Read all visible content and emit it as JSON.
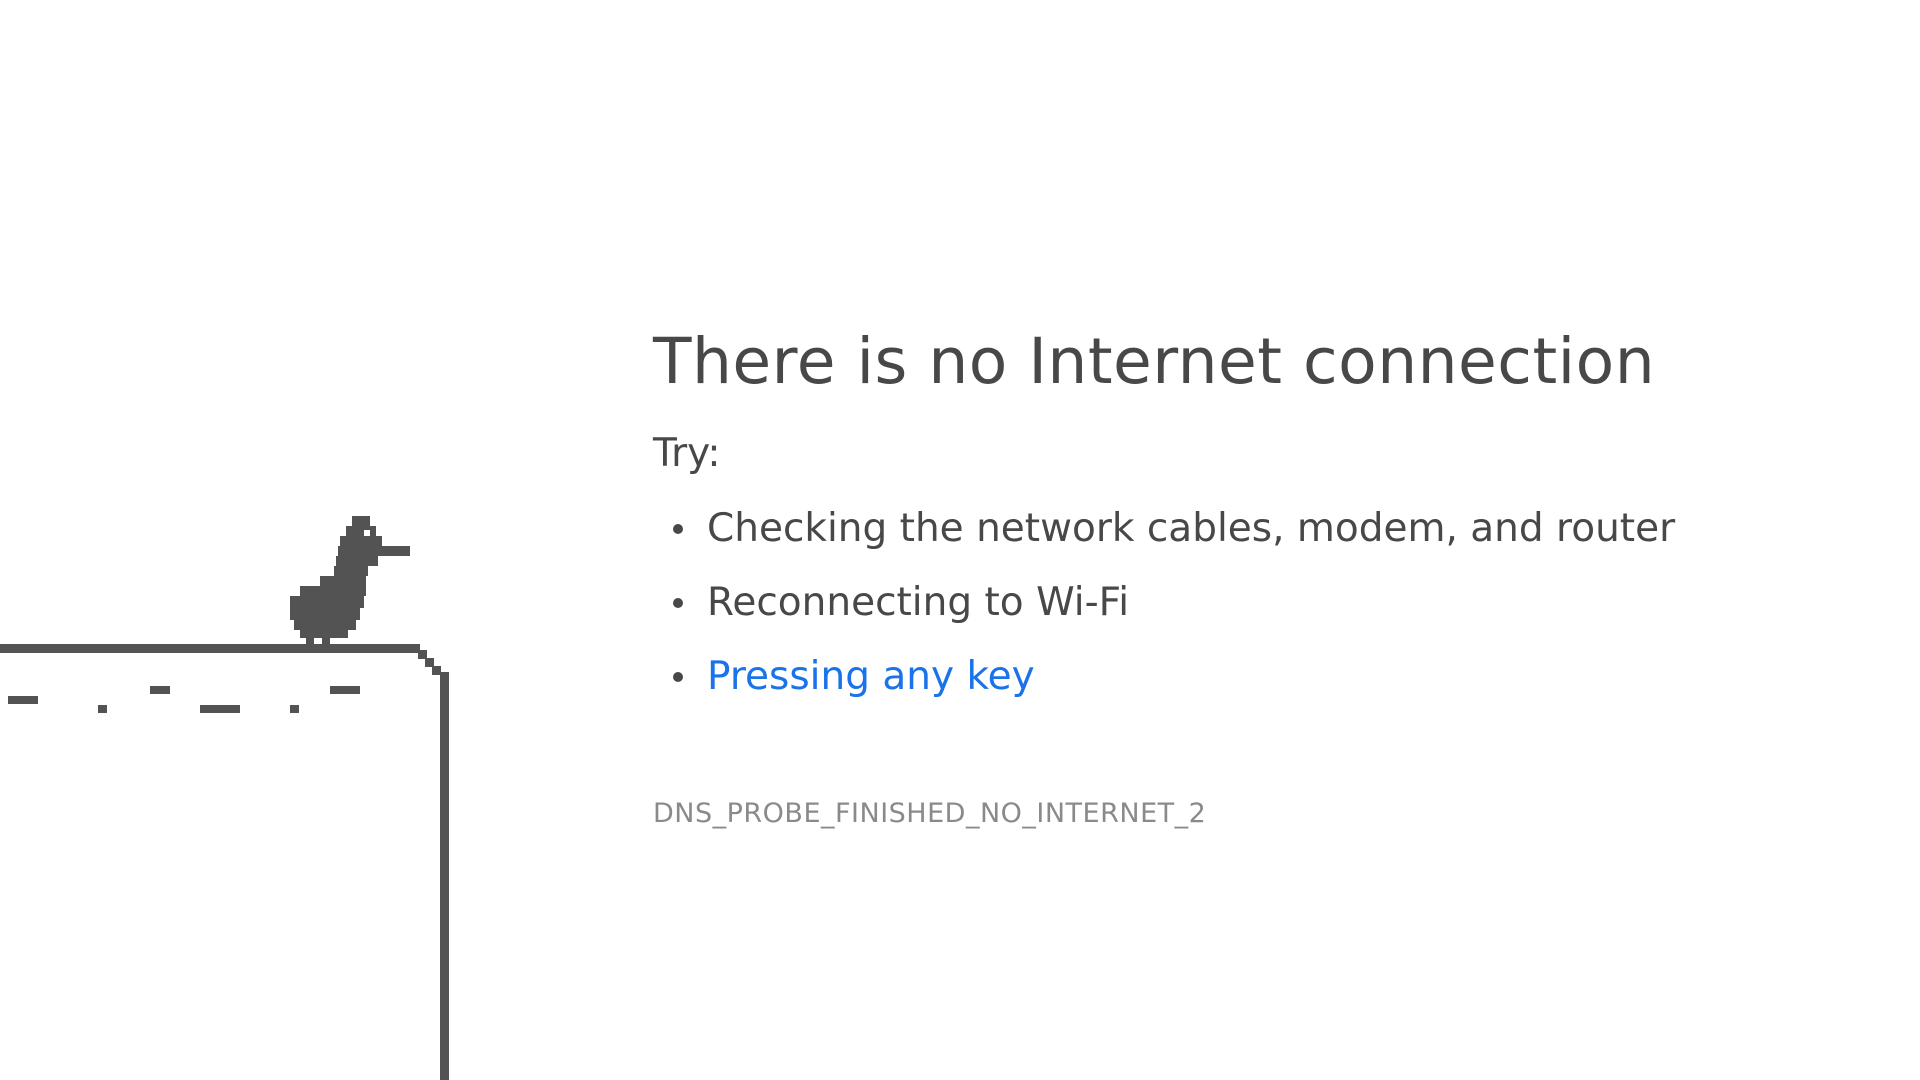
{
  "page": {
    "title": "There is no Internet connection",
    "try_label": "Try:",
    "suggestions": [
      {
        "label": "Checking the network cables, modem, and router",
        "is_link": false
      },
      {
        "label": "Reconnecting to Wi-Fi",
        "is_link": false
      },
      {
        "label": "Pressing any key",
        "is_link": true
      }
    ],
    "error_code": "DNS_PROBE_FINISHED_NO_INTERNET_2"
  },
  "illustration": {
    "icon": "offline-bird-on-cliff-icon",
    "color": "#535353"
  },
  "colors": {
    "text": "#484848",
    "link": "#1a73e8",
    "error_code": "#8a8a8a",
    "background": "#ffffff"
  }
}
